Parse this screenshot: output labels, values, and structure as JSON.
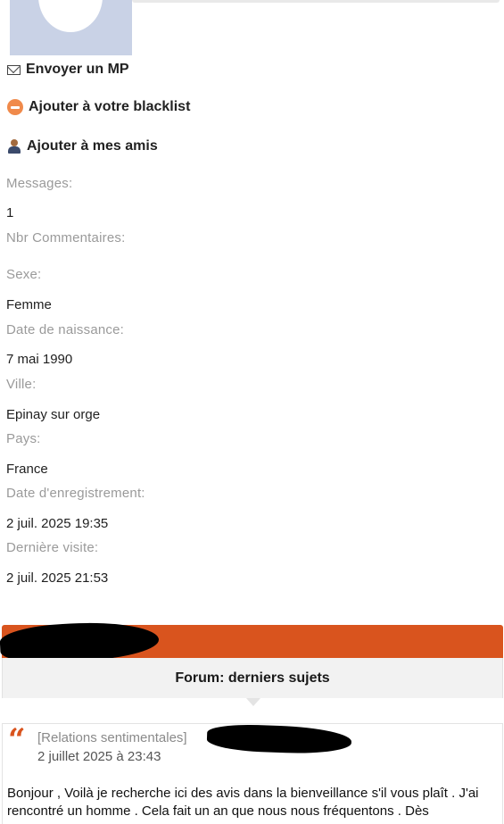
{
  "profile": {
    "actions": {
      "send_mp": "Envoyer un MP",
      "blacklist": "Ajouter à votre blacklist",
      "add_friend": "Ajouter à mes amis"
    },
    "fields": {
      "messages_label": "Messages:",
      "messages_value": "1",
      "comments_label": "Nbr Commentaires:",
      "comments_value": "",
      "sexe_label": "Sexe:",
      "sexe_value": "Femme",
      "birth_label": "Date de naissance:",
      "birth_value": "7 mai 1990",
      "city_label": "Ville:",
      "city_value": "Epinay sur orge",
      "country_label": "Pays:",
      "country_value": "France",
      "registered_label": "Date d'enregistrement:",
      "registered_value": "2 juil. 2025 19:35",
      "last_visit_label": "Dernière visite:",
      "last_visit_value": "2 juil. 2025 21:53"
    }
  },
  "forum": {
    "header": "Forum: derniers sujets",
    "post": {
      "quote_mark": "“",
      "category": "[Relations sentimentales]",
      "date": "2 juillet 2025 à 23:43",
      "text": "Bonjour , Voilà je recherche ici des avis dans la bienveillance s'il vous plaît . J'ai rencontré un homme . Cela fait un an que nous nous fréquentons . Dès"
    }
  },
  "colors": {
    "accent": "#d9541e",
    "label_gray": "#9a9a9a"
  },
  "icons": [
    "envelope-icon",
    "block-icon",
    "user-icon",
    "quote-icon"
  ]
}
